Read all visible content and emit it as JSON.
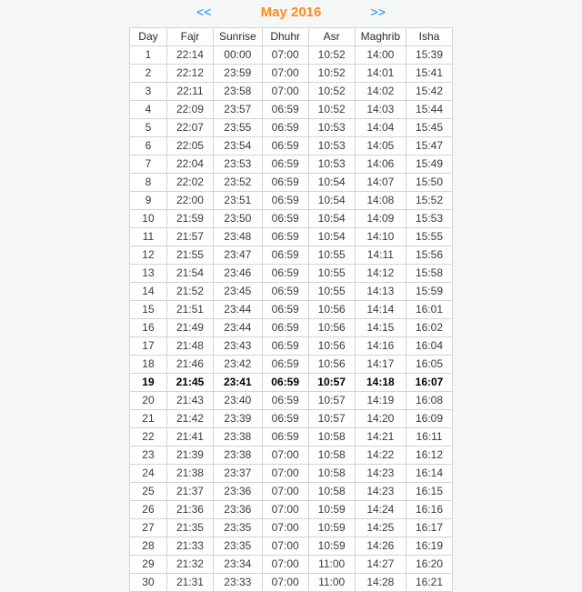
{
  "nav": {
    "prev": "<<",
    "title": "May 2016",
    "next": ">>"
  },
  "headers": [
    "Day",
    "Fajr",
    "Sunrise",
    "Dhuhr",
    "Asr",
    "Maghrib",
    "Isha"
  ],
  "today_index": 18,
  "rows": [
    [
      "1",
      "22:14",
      "00:00",
      "07:00",
      "10:52",
      "14:00",
      "15:39"
    ],
    [
      "2",
      "22:12",
      "23:59",
      "07:00",
      "10:52",
      "14:01",
      "15:41"
    ],
    [
      "3",
      "22:11",
      "23:58",
      "07:00",
      "10:52",
      "14:02",
      "15:42"
    ],
    [
      "4",
      "22:09",
      "23:57",
      "06:59",
      "10:52",
      "14:03",
      "15:44"
    ],
    [
      "5",
      "22:07",
      "23:55",
      "06:59",
      "10:53",
      "14:04",
      "15:45"
    ],
    [
      "6",
      "22:05",
      "23:54",
      "06:59",
      "10:53",
      "14:05",
      "15:47"
    ],
    [
      "7",
      "22:04",
      "23:53",
      "06:59",
      "10:53",
      "14:06",
      "15:49"
    ],
    [
      "8",
      "22:02",
      "23:52",
      "06:59",
      "10:54",
      "14:07",
      "15:50"
    ],
    [
      "9",
      "22:00",
      "23:51",
      "06:59",
      "10:54",
      "14:08",
      "15:52"
    ],
    [
      "10",
      "21:59",
      "23:50",
      "06:59",
      "10:54",
      "14:09",
      "15:53"
    ],
    [
      "11",
      "21:57",
      "23:48",
      "06:59",
      "10:54",
      "14:10",
      "15:55"
    ],
    [
      "12",
      "21:55",
      "23:47",
      "06:59",
      "10:55",
      "14:11",
      "15:56"
    ],
    [
      "13",
      "21:54",
      "23:46",
      "06:59",
      "10:55",
      "14:12",
      "15:58"
    ],
    [
      "14",
      "21:52",
      "23:45",
      "06:59",
      "10:55",
      "14:13",
      "15:59"
    ],
    [
      "15",
      "21:51",
      "23:44",
      "06:59",
      "10:56",
      "14:14",
      "16:01"
    ],
    [
      "16",
      "21:49",
      "23:44",
      "06:59",
      "10:56",
      "14:15",
      "16:02"
    ],
    [
      "17",
      "21:48",
      "23:43",
      "06:59",
      "10:56",
      "14:16",
      "16:04"
    ],
    [
      "18",
      "21:46",
      "23:42",
      "06:59",
      "10:56",
      "14:17",
      "16:05"
    ],
    [
      "19",
      "21:45",
      "23:41",
      "06:59",
      "10:57",
      "14:18",
      "16:07"
    ],
    [
      "20",
      "21:43",
      "23:40",
      "06:59",
      "10:57",
      "14:19",
      "16:08"
    ],
    [
      "21",
      "21:42",
      "23:39",
      "06:59",
      "10:57",
      "14:20",
      "16:09"
    ],
    [
      "22",
      "21:41",
      "23:38",
      "06:59",
      "10:58",
      "14:21",
      "16:11"
    ],
    [
      "23",
      "21:39",
      "23:38",
      "07:00",
      "10:58",
      "14:22",
      "16:12"
    ],
    [
      "24",
      "21:38",
      "23:37",
      "07:00",
      "10:58",
      "14:23",
      "16:14"
    ],
    [
      "25",
      "21:37",
      "23:36",
      "07:00",
      "10:58",
      "14:23",
      "16:15"
    ],
    [
      "26",
      "21:36",
      "23:36",
      "07:00",
      "10:59",
      "14:24",
      "16:16"
    ],
    [
      "27",
      "21:35",
      "23:35",
      "07:00",
      "10:59",
      "14:25",
      "16:17"
    ],
    [
      "28",
      "21:33",
      "23:35",
      "07:00",
      "10:59",
      "14:26",
      "16:19"
    ],
    [
      "29",
      "21:32",
      "23:34",
      "07:00",
      "11:00",
      "14:27",
      "16:20"
    ],
    [
      "30",
      "21:31",
      "23:33",
      "07:00",
      "11:00",
      "14:28",
      "16:21"
    ]
  ]
}
